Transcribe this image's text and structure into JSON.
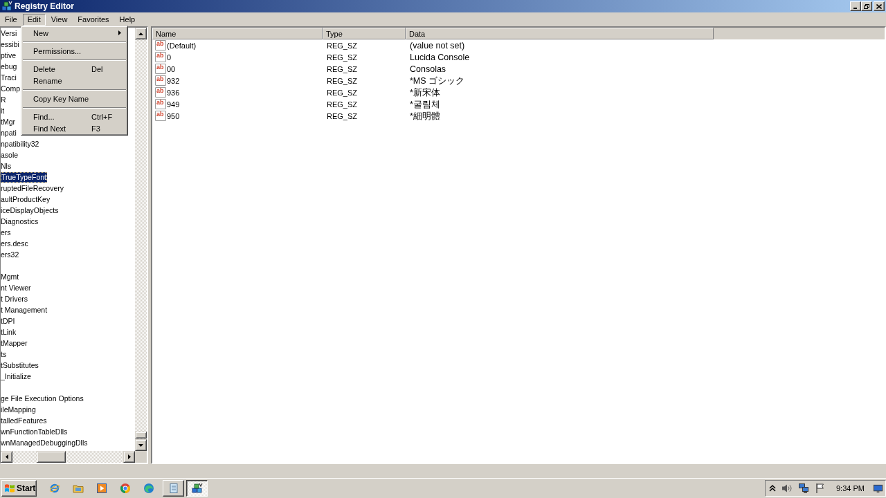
{
  "window": {
    "title": "Registry Editor"
  },
  "menu_bar": [
    {
      "label": "File",
      "selected": false
    },
    {
      "label": "Edit",
      "selected": true
    },
    {
      "label": "View",
      "selected": false
    },
    {
      "label": "Favorites",
      "selected": false
    },
    {
      "label": "Help",
      "selected": false
    }
  ],
  "edit_menu": [
    {
      "kind": "submenu",
      "label": "New"
    },
    {
      "kind": "separator"
    },
    {
      "kind": "command",
      "label": "Permissions..."
    },
    {
      "kind": "separator"
    },
    {
      "kind": "command",
      "label": "Delete",
      "shortcut": "Del"
    },
    {
      "kind": "command",
      "label": "Rename"
    },
    {
      "kind": "separator"
    },
    {
      "kind": "command",
      "label": "Copy Key Name"
    },
    {
      "kind": "separator"
    },
    {
      "kind": "command",
      "label": "Find...",
      "shortcut": "Ctrl+F"
    },
    {
      "kind": "command",
      "label": "Find Next",
      "shortcut": "F3"
    }
  ],
  "tree": [
    {
      "kind": "key",
      "label": "Versi",
      "selected": false
    },
    {
      "kind": "key",
      "label": "essibi",
      "selected": false
    },
    {
      "kind": "key",
      "label": "ptive",
      "selected": false
    },
    {
      "kind": "key",
      "label": "ebug",
      "selected": false
    },
    {
      "kind": "key",
      "label": "Traci",
      "selected": false
    },
    {
      "kind": "key",
      "label": "Comp",
      "selected": false
    },
    {
      "kind": "key",
      "label": "R",
      "selected": false
    },
    {
      "kind": "key",
      "label": "it",
      "selected": false
    },
    {
      "kind": "key",
      "label": "tMgr",
      "selected": false
    },
    {
      "kind": "key",
      "label": "npati",
      "selected": false
    },
    {
      "kind": "key",
      "label": "npatibility32",
      "selected": false
    },
    {
      "kind": "key",
      "label": "asole",
      "selected": false
    },
    {
      "kind": "key",
      "label": "Nls",
      "selected": false
    },
    {
      "kind": "key",
      "label": "TrueTypeFont",
      "selected": true
    },
    {
      "kind": "key",
      "label": "ruptedFileRecovery",
      "selected": false
    },
    {
      "kind": "key",
      "label": "aultProductKey",
      "selected": false
    },
    {
      "kind": "key",
      "label": "iceDisplayObjects",
      "selected": false
    },
    {
      "kind": "key",
      "label": "Diagnostics",
      "selected": false
    },
    {
      "kind": "key",
      "label": "ers",
      "selected": false
    },
    {
      "kind": "key",
      "label": "ers.desc",
      "selected": false
    },
    {
      "kind": "key",
      "label": "ers32",
      "selected": false
    },
    {
      "kind": "blank"
    },
    {
      "kind": "key",
      "label": "Mgmt",
      "selected": false
    },
    {
      "kind": "key",
      "label": "nt Viewer",
      "selected": false
    },
    {
      "kind": "key",
      "label": "t Drivers",
      "selected": false
    },
    {
      "kind": "key",
      "label": "t Management",
      "selected": false
    },
    {
      "kind": "key",
      "label": "tDPI",
      "selected": false
    },
    {
      "kind": "key",
      "label": "tLink",
      "selected": false
    },
    {
      "kind": "key",
      "label": "tMapper",
      "selected": false
    },
    {
      "kind": "key",
      "label": "ts",
      "selected": false
    },
    {
      "kind": "key",
      "label": "tSubstitutes",
      "selected": false
    },
    {
      "kind": "key",
      "label": "_Initialize",
      "selected": false
    },
    {
      "kind": "blank"
    },
    {
      "kind": "key",
      "label": "ge File Execution Options",
      "selected": false
    },
    {
      "kind": "key",
      "label": "ileMapping",
      "selected": false
    },
    {
      "kind": "key",
      "label": "talledFeatures",
      "selected": false
    },
    {
      "kind": "key",
      "label": "wnFunctionTableDlls",
      "selected": false
    },
    {
      "kind": "key",
      "label": "wnManagedDebuggingDlls",
      "selected": false
    }
  ],
  "values": {
    "columns": [
      "Name",
      "Type",
      "Data"
    ],
    "rows": [
      {
        "type_badge": "ab",
        "name": "(Default)",
        "type": "REG_SZ",
        "data": "(value not set)"
      },
      {
        "type_badge": "ab",
        "name": "0",
        "type": "REG_SZ",
        "data": "Lucida Console"
      },
      {
        "type_badge": "ab",
        "name": "00",
        "type": "REG_SZ",
        "data": "Consolas"
      },
      {
        "type_badge": "ab",
        "name": "932",
        "type": "REG_SZ",
        "data": "*MS ゴシック"
      },
      {
        "type_badge": "ab",
        "name": "936",
        "type": "REG_SZ",
        "data": "*新宋体"
      },
      {
        "type_badge": "ab",
        "name": "949",
        "type": "REG_SZ",
        "data": "*굴림체"
      },
      {
        "type_badge": "ab",
        "name": "950",
        "type": "REG_SZ",
        "data": "*細明體"
      }
    ]
  },
  "taskbar": {
    "start": "Start",
    "windows": [
      {
        "selected": false
      },
      {
        "selected": true
      }
    ],
    "clock": "9:34 PM"
  }
}
